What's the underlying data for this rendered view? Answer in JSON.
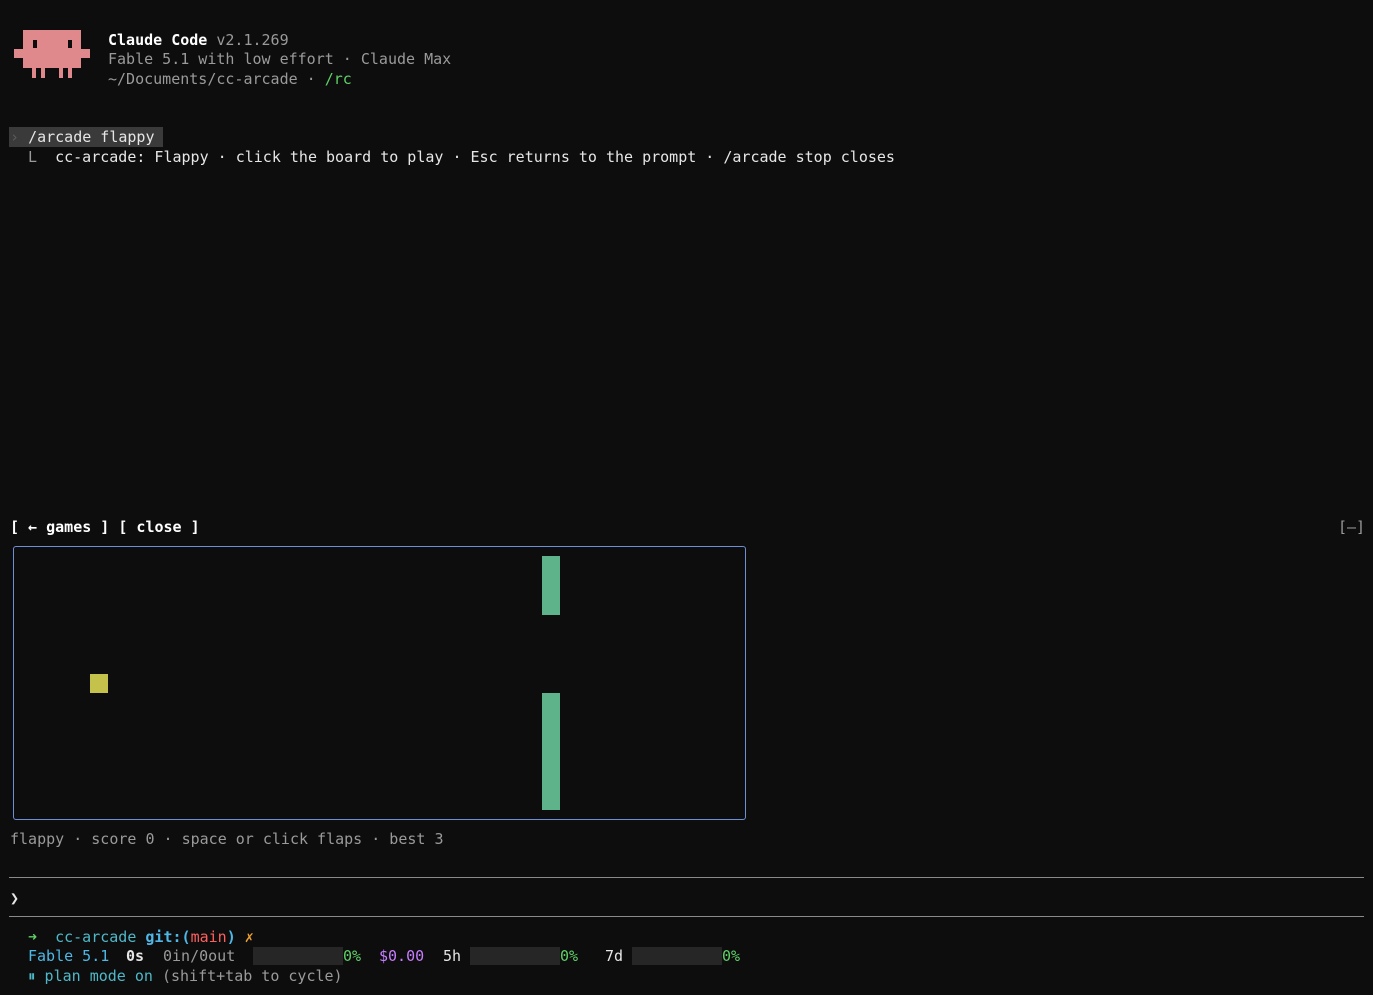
{
  "header": {
    "app_name": "Claude Code",
    "version": "v2.1.269",
    "model_line": "Fable 5.1 with low effort · Claude Max",
    "path": "~/Documents/cc-arcade",
    "separator": " · ",
    "rc": "/rc"
  },
  "command": {
    "caret": "›",
    "text": "/arcade flappy",
    "result_prefix": "L",
    "result": "cc-arcade: Flappy · click the board to play · Esc returns to the prompt · /arcade stop closes"
  },
  "panel": {
    "games_button": "[ ← games ]",
    "close_button": "[ close ]",
    "minimize_button": "[–]",
    "status_line": "flappy · score 0 · space or click flaps · best 3",
    "game": {
      "score": 0,
      "best": 3,
      "colors": {
        "pipe": "#5fb38a",
        "bird": "#c4c24a",
        "border": "#6e8fd6"
      }
    }
  },
  "prompt": {
    "caret": "❯",
    "value": ""
  },
  "statusbar": {
    "arrow": "➜",
    "dir": "cc-arcade",
    "git_label": "git:(",
    "branch": "main",
    "git_close": ")",
    "dirty": "✗",
    "model": "Fable 5.1",
    "elapsed": "0s",
    "tokens": "0in/0out",
    "context_pct": "0%",
    "cost": "$0.00",
    "five_h_label": "5h",
    "five_h_pct": "0%",
    "seven_d_label": "7d",
    "seven_d_pct": "0%",
    "plan_icon": "⏸",
    "plan_text": "plan mode on",
    "plan_hint": "(shift+tab to cycle)"
  }
}
